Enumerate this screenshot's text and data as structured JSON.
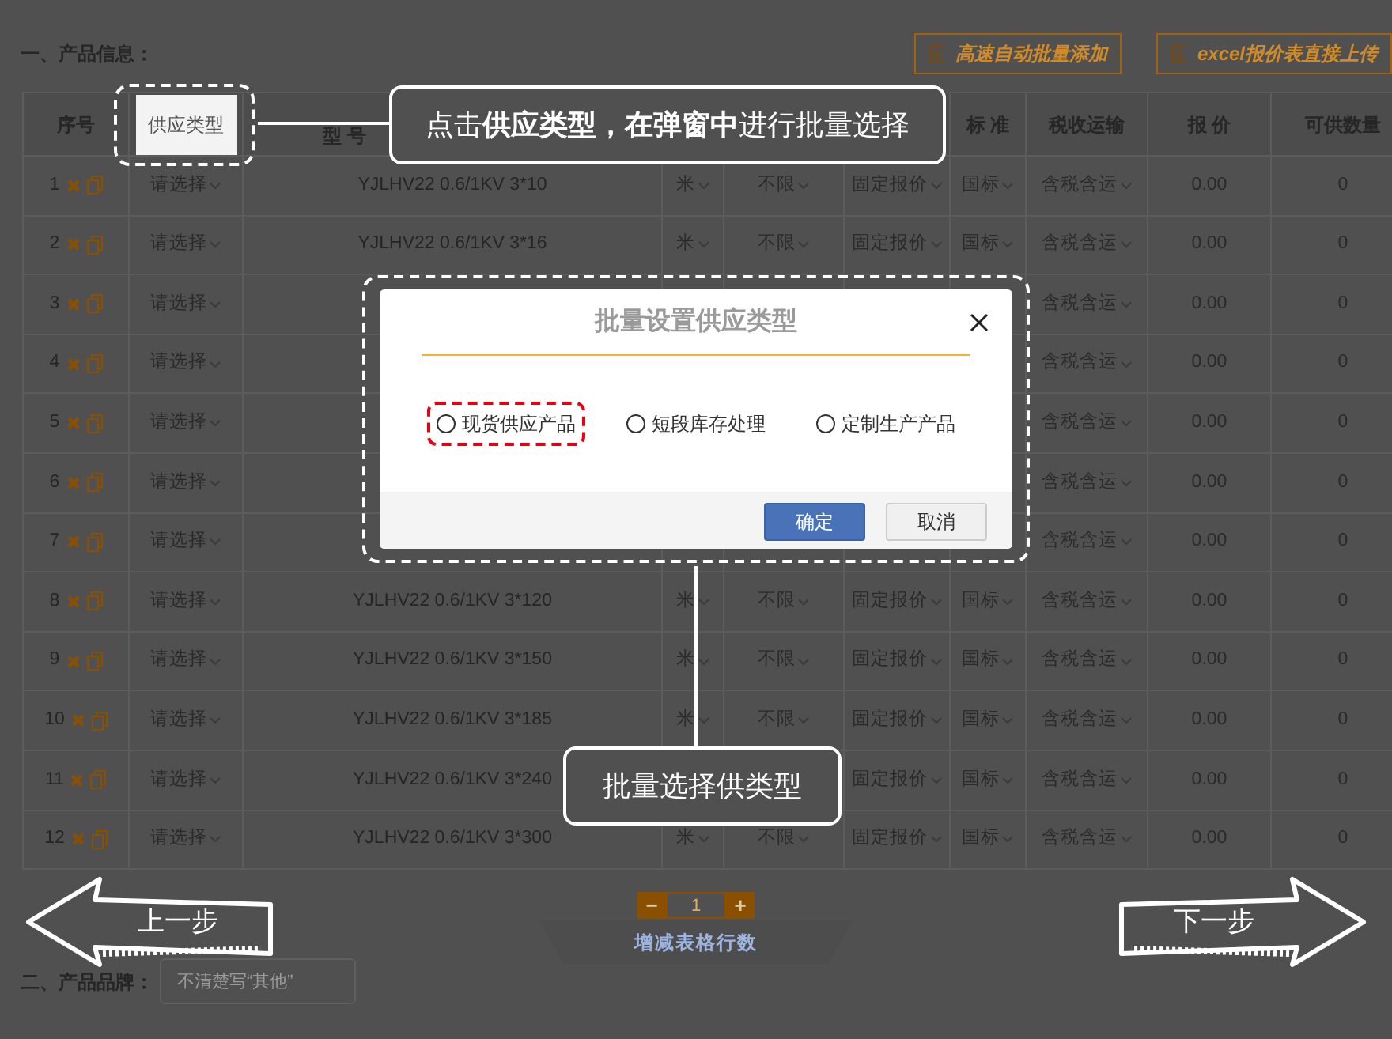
{
  "section_title": "一、产品信息：",
  "toolbar_buttons": [
    {
      "label": "高速自动批量添加"
    },
    {
      "label": "excel报价表直接上传"
    }
  ],
  "table": {
    "columns": [
      {
        "label": "序号",
        "highlighted": false
      },
      {
        "label": "供应类型",
        "highlighted": true
      },
      {
        "label": "型 号",
        "highlighted": false
      },
      {},
      {},
      {
        "highlighted": false
      },
      {
        "label": "标 准",
        "highlighted": false
      },
      {
        "label": "税收运输",
        "highlighted": false
      },
      {
        "label": "报 价",
        "highlighted": false
      },
      {
        "label": "可供数量",
        "highlighted": false
      }
    ],
    "rows": [
      {
        "index": "1",
        "supply": "请选择",
        "model": "YJLHV22 0.6/1KV 3*10",
        "unit": "米",
        "limit": "不限",
        "pricing": "固定报价",
        "standard": "国标",
        "tax": "含税含运",
        "price": "0.00",
        "quantity": "0"
      },
      {
        "index": "2",
        "supply": "请选择",
        "model": "YJLHV22 0.6/1KV 3*16",
        "unit": "米",
        "limit": "不限",
        "pricing": "固定报价",
        "standard": "国标",
        "tax": "含税含运",
        "price": "0.00",
        "quantity": "0"
      },
      {
        "index": "3",
        "supply": "请选择",
        "tax": "含税含运",
        "price": "0.00",
        "quantity": "0"
      },
      {
        "index": "4",
        "supply": "请选择",
        "tax": "含税含运",
        "price": "0.00",
        "quantity": "0"
      },
      {
        "index": "5",
        "supply": "请选择",
        "tax": "含税含运",
        "price": "0.00",
        "quantity": "0"
      },
      {
        "index": "6",
        "supply": "请选择",
        "tax": "含税含运",
        "price": "0.00",
        "quantity": "0"
      },
      {
        "index": "7",
        "supply": "请选择",
        "tax": "含税含运",
        "price": "0.00",
        "quantity": "0"
      },
      {
        "index": "8",
        "supply": "请选择",
        "model": "YJLHV22 0.6/1KV 3*120",
        "unit": "米",
        "limit": "不限",
        "pricing": "固定报价",
        "standard": "国标",
        "tax": "含税含运",
        "price": "0.00",
        "quantity": "0"
      },
      {
        "index": "9",
        "supply": "请选择",
        "model": "YJLHV22 0.6/1KV 3*150",
        "unit": "米",
        "limit": "不限",
        "pricing": "固定报价",
        "standard": "国标",
        "tax": "含税含运",
        "price": "0.00",
        "quantity": "0"
      },
      {
        "index": "10",
        "supply": "请选择",
        "model": "YJLHV22 0.6/1KV 3*185",
        "unit": "米",
        "limit": "不限",
        "pricing": "固定报价",
        "standard": "国标",
        "tax": "含税含运",
        "price": "0.00",
        "quantity": "0"
      },
      {
        "index": "11",
        "supply": "请选择",
        "model": "YJLHV22 0.6/1KV 3*240",
        "pricing": "固定报价",
        "standard": "国标",
        "tax": "含税含运",
        "price": "0.00",
        "quantity": "0"
      },
      {
        "index": "12",
        "supply": "请选择",
        "model": "YJLHV22 0.6/1KV 3*300",
        "unit": "米",
        "limit": "不限",
        "pricing": "固定报价",
        "standard": "国标",
        "tax": "含税含运",
        "price": "0.00",
        "quantity": "0"
      }
    ]
  },
  "row_stepper": {
    "minus": "−",
    "value": "1",
    "plus": "+",
    "label": "增减表格行数"
  },
  "brand": {
    "label": "二、产品品牌：",
    "placeholder": "不清楚写“其他”"
  },
  "callouts": [
    {
      "text": "点击**供应类型，在弹窗中**进行批量选择"
    },
    {
      "text": "批量选择供类型"
    }
  ],
  "modal": {
    "title": "批量设置供应类型",
    "options": [
      {
        "label": "现货供应产品",
        "selected": false,
        "highlighted": true
      },
      {
        "label": "短段库存处理",
        "selected": false,
        "highlighted": false
      },
      {
        "label": "定制生产产品",
        "selected": false,
        "highlighted": false
      }
    ],
    "buttons": [
      {
        "label": "确定",
        "kind": "primary"
      },
      {
        "label": "取消",
        "kind": "secondary"
      }
    ]
  },
  "navigation": {
    "previous": "上一步",
    "next": "下一步"
  }
}
